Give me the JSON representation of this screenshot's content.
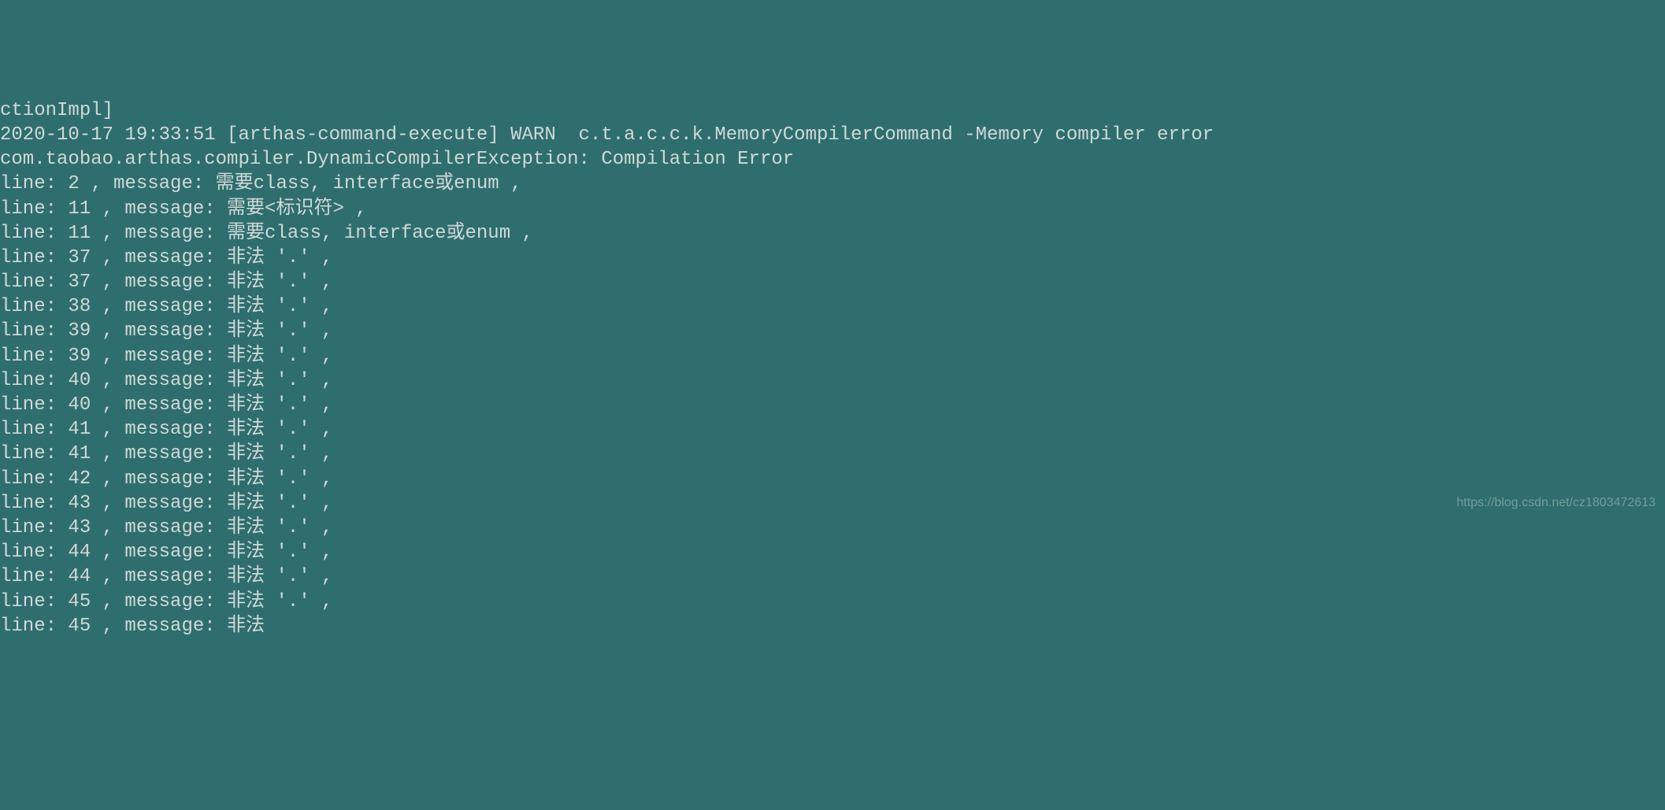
{
  "terminal": {
    "partial_top": "ctionImpl]",
    "log_line": "2020-10-17 19:33:51 [arthas-command-execute] WARN  c.t.a.c.c.k.MemoryCompilerCommand -Memory compiler error",
    "exception_line": "com.taobao.arthas.compiler.DynamicCompilerException: Compilation Error",
    "errors": [
      {
        "line": "2",
        "message": "需要class, interface或enum"
      },
      {
        "line": "11",
        "message": "需要<标识符>"
      },
      {
        "line": "11",
        "message": "需要class, interface或enum"
      },
      {
        "line": "37",
        "message": "非法 '.'"
      },
      {
        "line": "37",
        "message": "非法 '.'"
      },
      {
        "line": "38",
        "message": "非法 '.'"
      },
      {
        "line": "39",
        "message": "非法 '.'"
      },
      {
        "line": "39",
        "message": "非法 '.'"
      },
      {
        "line": "40",
        "message": "非法 '.'"
      },
      {
        "line": "40",
        "message": "非法 '.'"
      },
      {
        "line": "41",
        "message": "非法 '.'"
      },
      {
        "line": "41",
        "message": "非法 '.'"
      },
      {
        "line": "42",
        "message": "非法 '.'"
      },
      {
        "line": "43",
        "message": "非法 '.'"
      },
      {
        "line": "43",
        "message": "非法 '.'"
      },
      {
        "line": "44",
        "message": "非法 '.'"
      },
      {
        "line": "44",
        "message": "非法 '.'"
      },
      {
        "line": "45",
        "message": "非法 '.'"
      }
    ],
    "partial_bottom_line": "45",
    "partial_bottom_msg": "非法"
  },
  "watermark": "https://blog.csdn.net/cz1803472613"
}
